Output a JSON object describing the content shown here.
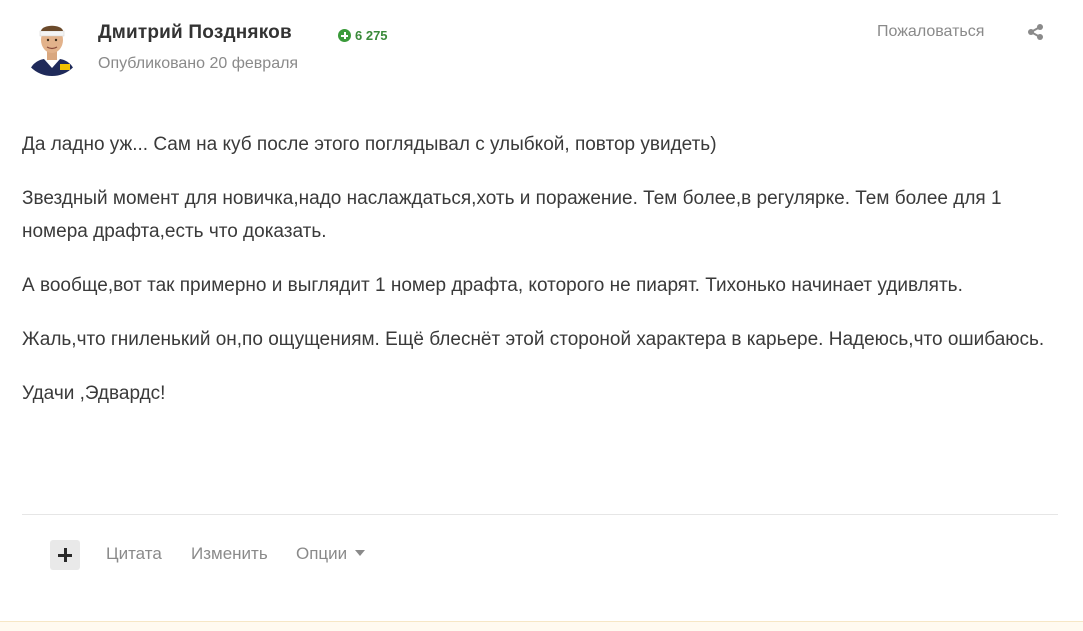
{
  "post": {
    "author": {
      "name": "Дмитрий Поздняков",
      "reputation": "6 275",
      "avatar_icon": "player-avatar-image"
    },
    "published": "Опубликовано 20 февраля",
    "report_label": "Пожаловаться",
    "share_icon": "share-icon",
    "paragraphs": [
      "Да ладно уж... Сам на куб после этого поглядывал с улыбкой, повтор увидеть)",
      "Звездный момент для новичка,надо наслаждаться,хоть и поражение. Тем более,в регулярке. Тем более для 1 номера драфта,есть что доказать.",
      "А вообще,вот так примерно и выглядит 1 номер драфта, которого не пиарят. Тихонько начинает удивлять.",
      "Жаль,что гниленький он,по ощущениям. Ещё блеснёт этой стороной характера в карьере. Надеюсь,что ошибаюсь.",
      "Удачи ,Эдвардс!"
    ],
    "actions": {
      "quote_label": "Цитата",
      "edit_label": "Изменить",
      "options_label": "Опции"
    }
  },
  "colors": {
    "reputation_green": "#3a8a3a",
    "muted_text": "#8a8a8a",
    "body_text": "#3a3a3a"
  }
}
